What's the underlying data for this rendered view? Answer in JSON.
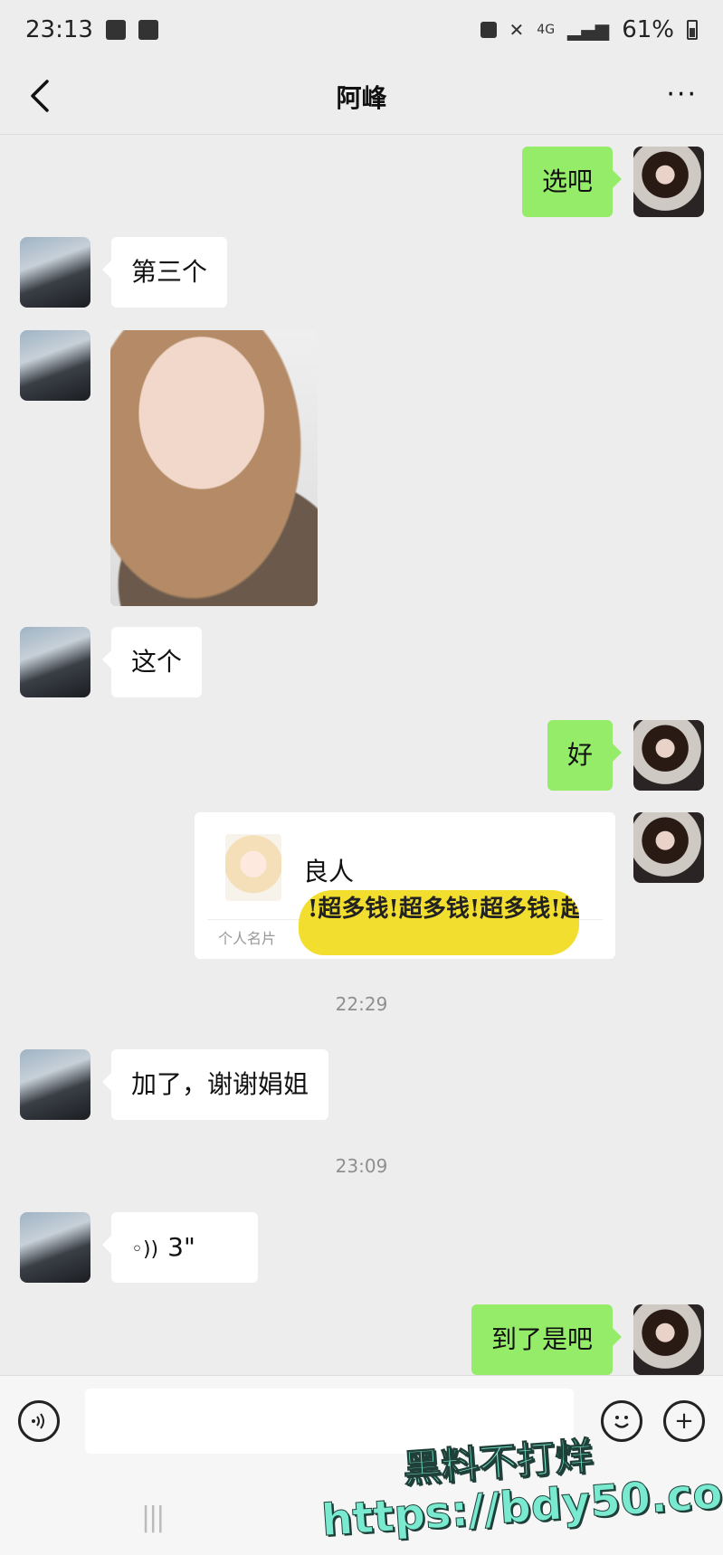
{
  "status_bar": {
    "time": "23:13",
    "network": "4G",
    "battery": "61%"
  },
  "nav": {
    "title": "阿峰",
    "back_icon": "chevron-left-icon",
    "more_label": "···"
  },
  "messages": {
    "m1": {
      "sender": "me",
      "text": "选吧"
    },
    "m2": {
      "sender": "friend",
      "text": "第三个"
    },
    "m3": {
      "sender": "friend",
      "type": "image"
    },
    "m4": {
      "sender": "friend",
      "text": "这个"
    },
    "m5": {
      "sender": "me",
      "text": "好"
    },
    "m6": {
      "sender": "me",
      "type": "contact_card",
      "name": "良人",
      "label": "个人名片",
      "sticker_text": "!超多钱!超多钱!超多钱!超多钱!超多钱!"
    },
    "t1": "22:29",
    "m7": {
      "sender": "friend",
      "text": "加了，谢谢娟姐"
    },
    "t2": "23:09",
    "m8": {
      "sender": "friend",
      "type": "voice",
      "duration": "3\""
    },
    "m9": {
      "sender": "me",
      "text": "到了是吧"
    }
  },
  "input_bar": {
    "voice_icon": "voice-icon",
    "emoji_icon": "emoji-icon",
    "plus_icon": "plus-icon",
    "plus_label": "+",
    "placeholder": ""
  },
  "watermark": {
    "line1": "黑料不打烊",
    "line2": "https://bdy50.co"
  },
  "colors": {
    "background": "#ededed",
    "outgoing_bubble": "#95ec69",
    "incoming_bubble": "#ffffff",
    "watermark": "#79ead0"
  }
}
